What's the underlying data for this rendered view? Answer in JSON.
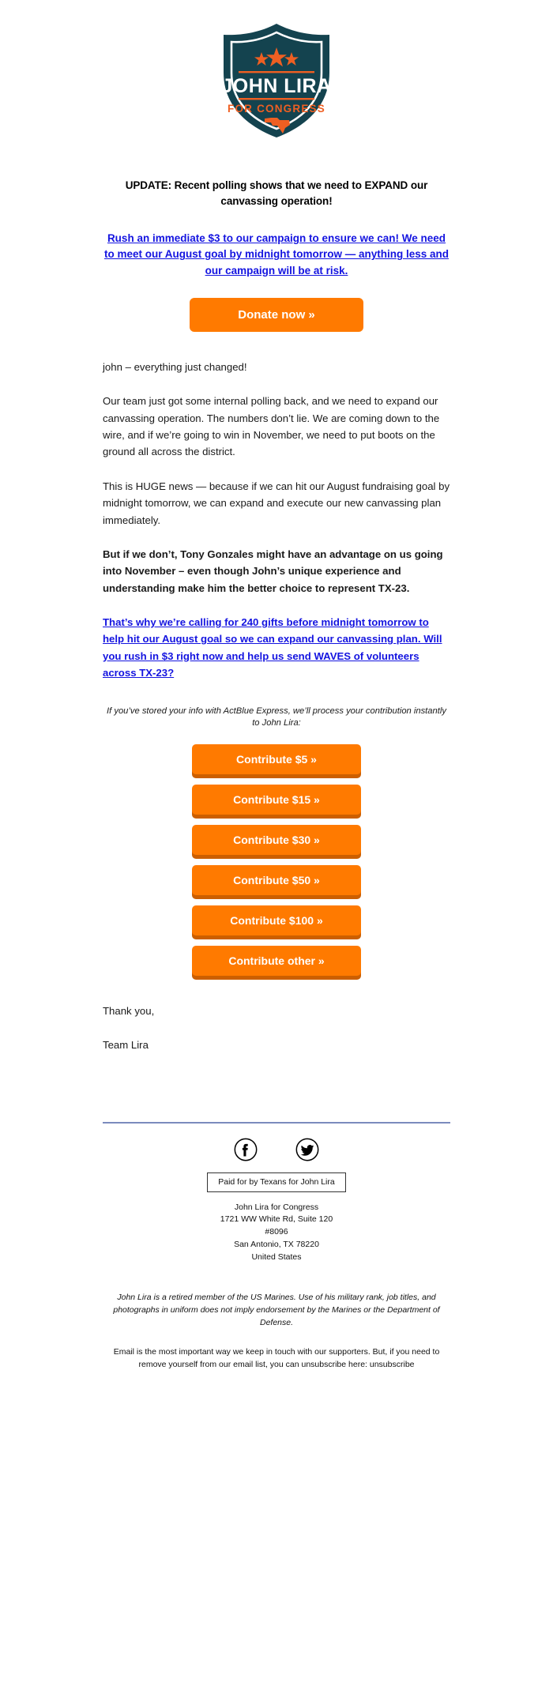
{
  "brand": {
    "logo_name_line": "JOHN LIRA",
    "logo_tagline": "FOR CONGRESS",
    "colors": {
      "shield_navy": "#14434f",
      "accent_orange": "#ef5f22",
      "button_orange": "#ff7a00",
      "button_shadow": "#cc5f00",
      "link_blue": "#1414e0",
      "divider_blue": "#7b8bbd"
    }
  },
  "headline": "UPDATE: Recent polling shows that we need to EXPAND our canvassing operation!",
  "lead_link": "Rush an immediate $3 to our campaign to ensure we can! We need to meet our August goal by midnight tomorrow — anything less and our campaign will be at risk.",
  "donate_button": "Donate now »",
  "body": {
    "greeting": "john – everything just changed!",
    "para_1": "Our team just got some internal polling back, and we need to expand our canvassing operation. The numbers don’t lie. We are coming down to the wire, and if we’re going to win in November, we need to put boots on the ground all across the district.",
    "para_2": "This is HUGE news — because if we can hit our August fundraising goal by midnight tomorrow, we can expand and execute our new canvassing plan immediately.",
    "para_3_bold": "But if we don’t, Tony Gonzales might have an advantage on us going into November – even though John’s unique experience and understanding make him the better choice to represent TX-23.",
    "para_4_link": "That’s why we’re calling for 240 gifts before midnight tomorrow to help hit our August goal so we can expand our canvassing plan. Will you rush in $3 right now and help us send WAVES of volunteers across TX-23?"
  },
  "express_note": "If you’ve stored your info with ActBlue Express, we’ll process your contribution instantly to John Lira:",
  "contribute_buttons": [
    {
      "label": "Contribute $5 »"
    },
    {
      "label": "Contribute $15 »"
    },
    {
      "label": "Contribute $30 »"
    },
    {
      "label": "Contribute $50 »"
    },
    {
      "label": "Contribute $100 »"
    },
    {
      "label": "Contribute other »"
    }
  ],
  "signoff": {
    "thanks": "Thank you,",
    "team": "Team Lira"
  },
  "footer": {
    "social": [
      {
        "name": "facebook-icon",
        "glyph": "f"
      },
      {
        "name": "twitter-icon",
        "glyph": "bird"
      }
    ],
    "paid_for": "Paid for by Texans for John Lira",
    "address_lines": [
      "John Lira for Congress",
      "1721 WW White Rd, Suite 120",
      "#8096",
      "San Antonio, TX 78220",
      "United States"
    ],
    "disclaimer": "John Lira is a retired member of the US Marines. Use of his military rank, job titles, and photographs in uniform does not imply endorsement by the Marines or the Department of Defense.",
    "unsubscribe_text": "Email is the most important way we keep in touch with our supporters. But, if you need to remove yourself from our email list, you can unsubscribe here: ",
    "unsubscribe_link": "unsubscribe"
  }
}
